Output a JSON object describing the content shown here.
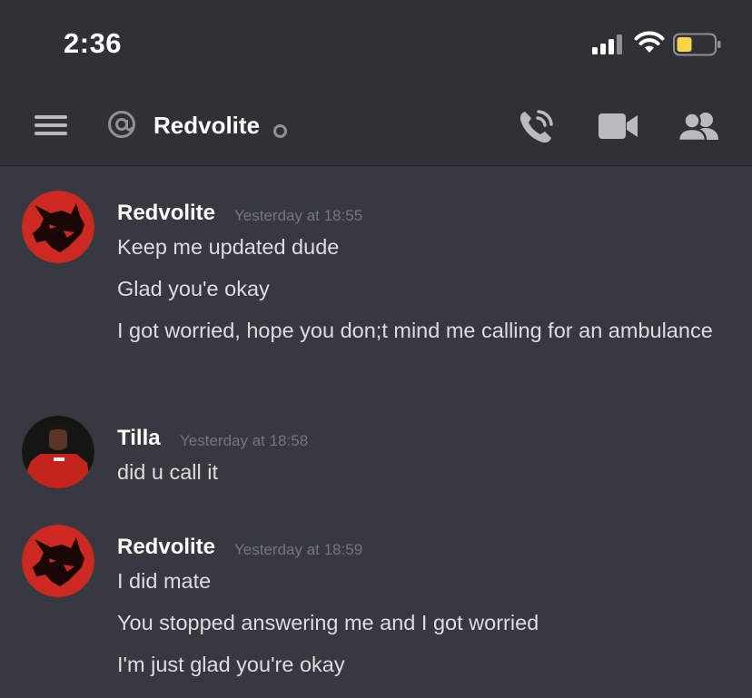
{
  "status_bar": {
    "time": "2:36"
  },
  "header": {
    "channel_name": "Redvolite"
  },
  "colors": {
    "background": "#36393f",
    "header_background": "#2f3136",
    "battery_fill": "#f7d547",
    "avatar_red": "#cc2a20"
  },
  "icons": [
    "hamburger-icon",
    "at-icon",
    "status-dot-icon",
    "phone-call-icon",
    "video-camera-icon",
    "members-icon"
  ],
  "messages": [
    {
      "author": "Redvolite",
      "timestamp": "Yesterday at 18:55",
      "lines": [
        "Keep me updated dude",
        "Glad you'e okay",
        "I got worried, hope you don;t mind me calling for an ambulance"
      ]
    },
    {
      "author": "Tilla",
      "timestamp": "Yesterday at 18:58",
      "lines": [
        "did u call it"
      ]
    },
    {
      "author": "Redvolite",
      "timestamp": "Yesterday at 18:59",
      "lines": [
        "I did mate",
        "You stopped answering me and I got worried",
        "I'm just glad you're okay"
      ]
    }
  ]
}
